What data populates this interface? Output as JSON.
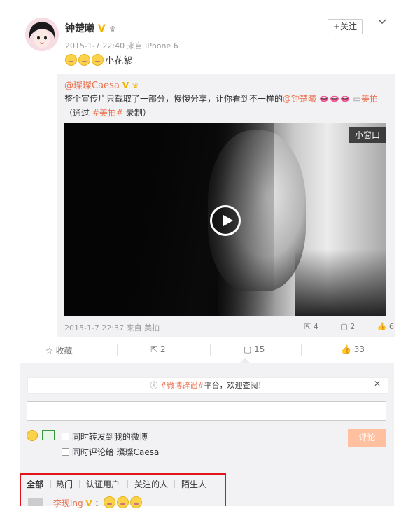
{
  "post": {
    "author": "钟楚曦",
    "verified_badge": "V",
    "time": "2015-1-7 22:40",
    "source": "来自 iPhone 6",
    "text": "小花絮",
    "follow_label": "+关注"
  },
  "repost": {
    "author": "@璨璨Caesa",
    "text_line1": "整个宣传片只截取了一部分，慢慢分享，让你看到不一样的",
    "mention": "@钟楚曦",
    "link_text": "美拍",
    "text_line2_prefix": "（通过 ",
    "hashtag": "#美拍#",
    "text_line2_suffix": " 录制）",
    "pip_label": "小窗口",
    "time_source": "2015-1-7 22:37 来自 美拍",
    "reposts": "4",
    "comments": "2",
    "likes": "6"
  },
  "actions": {
    "favorite_label": "收藏",
    "repost_count": "2",
    "comment_count": "15",
    "like_count": "33"
  },
  "comments": {
    "notice_prefix": "#微博辟谣#",
    "notice_suffix": "平台，欢迎查阅！",
    "option_repost": "同时转发到我的微博",
    "option_comment": "同时评论给 璨璨Caesa",
    "submit_label": "评论",
    "filters": [
      "全部",
      "热门",
      "认证用户",
      "关注的人",
      "陌生人"
    ],
    "first_commenter": "李现ing"
  },
  "colors": {
    "accent": "#eb7350",
    "highlight_border": "#e0141b",
    "verified": "#f2b200"
  }
}
